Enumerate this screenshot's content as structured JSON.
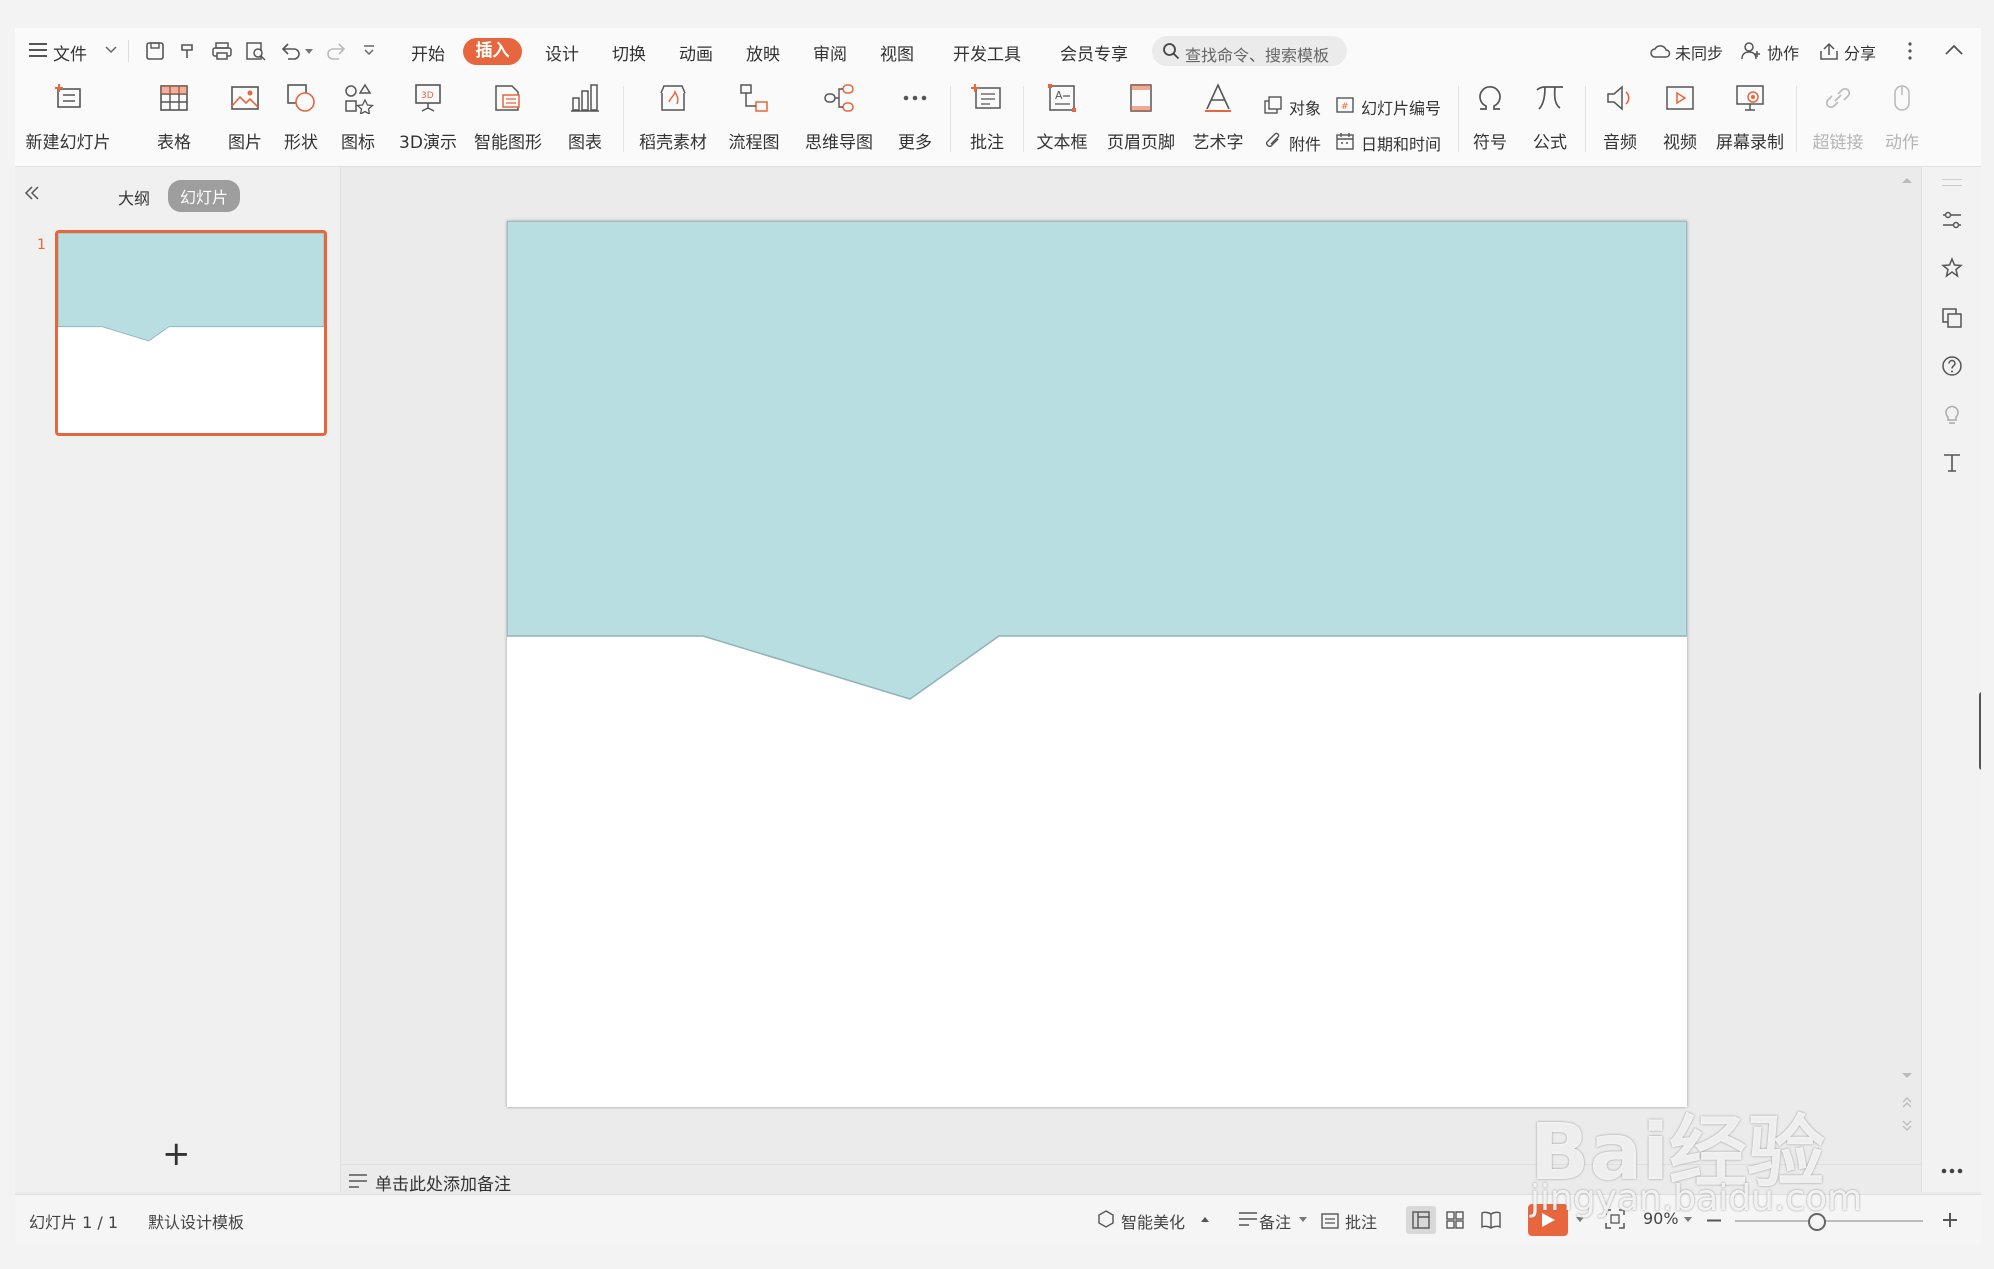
{
  "menubar": {
    "file": "文件",
    "tabs": [
      "开始",
      "插入",
      "设计",
      "切换",
      "动画",
      "放映",
      "审阅",
      "视图",
      "开发工具",
      "会员专享"
    ],
    "active_tab": "插入",
    "search_placeholder": "查找命令、搜索模板",
    "sync": "未同步",
    "collab": "协作",
    "share": "分享"
  },
  "ribbon": {
    "new_slide": "新建幻灯片",
    "table": "表格",
    "picture": "图片",
    "shape": "形状",
    "icon": "图标",
    "demo3d": "3D演示",
    "smartart": "智能图形",
    "chart": "图表",
    "material": "稻壳素材",
    "flowchart": "流程图",
    "mindmap": "思维导图",
    "more": "更多",
    "comment": "批注",
    "textbox": "文本框",
    "header_footer": "页眉页脚",
    "wordart": "艺术字",
    "object": "对象",
    "slide_number": "幻灯片编号",
    "attachment": "附件",
    "datetime": "日期和时间",
    "symbol": "符号",
    "formula": "公式",
    "audio": "音频",
    "video": "视频",
    "screen_record": "屏幕录制",
    "hyperlink": "超链接",
    "action": "动作"
  },
  "leftpanel": {
    "outline": "大纲",
    "slides": "幻灯片",
    "slide_index": "1",
    "add": "+"
  },
  "notes_placeholder": "单击此处添加备注",
  "slide": {
    "top_color": "#b9dee1",
    "outline_color": "#8fb3b6"
  },
  "statusbar": {
    "slide_info": "幻灯片 1 / 1",
    "template": "默认设计模板",
    "beautify": "智能美化",
    "notes": "备注",
    "comments": "批注",
    "zoom": "90%"
  },
  "colors": {
    "accent": "#e8663d"
  },
  "watermark": {
    "brand": "Bai经验",
    "url": "jingyan.baidu.com"
  }
}
